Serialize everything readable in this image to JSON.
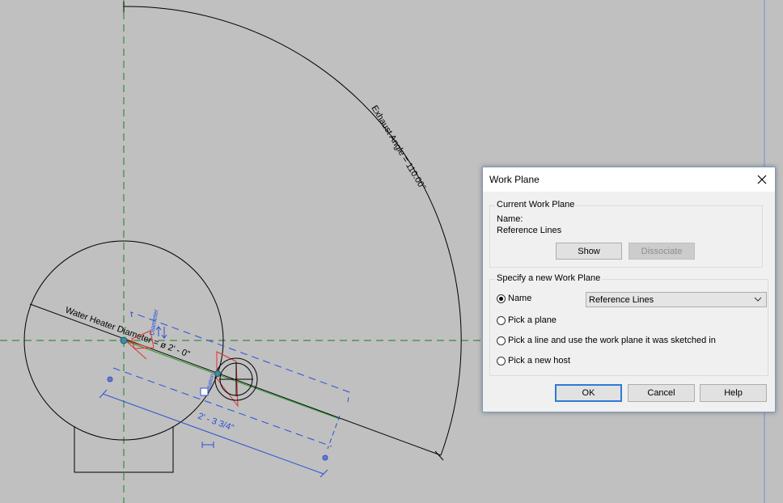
{
  "drawing": {
    "exhaust_angle_label": "Exhaust Angle = 110.00°",
    "diameter_label": "Water Heater Diameter = ø 2' - 0\"",
    "diameter_param": "Diameter",
    "length_dim": "2' - 3 3/4\"",
    "rotation_param": "Rotation"
  },
  "dialog": {
    "title": "Work Plane",
    "current": {
      "group_title": "Current Work Plane",
      "name_label": "Name:",
      "name_value": "Reference Lines",
      "show_label": "Show",
      "dissociate_label": "Dissociate"
    },
    "specify": {
      "group_title": "Specify a new Work Plane",
      "options": [
        {
          "label": "Name",
          "checked": true
        },
        {
          "label": "Pick a plane",
          "checked": false
        },
        {
          "label": "Pick a line and use the work plane it was sketched in",
          "checked": false
        },
        {
          "label": "Pick a new host",
          "checked": false
        }
      ],
      "name_select_value": "Reference Lines"
    },
    "buttons": {
      "ok": "OK",
      "cancel": "Cancel",
      "help": "Help"
    }
  },
  "colors": {
    "canvas": "#c0c0c0",
    "reference_plane": "#3c8a3c",
    "dimension_blue": "#2a4fd8",
    "accent": "#2f7ad6"
  }
}
